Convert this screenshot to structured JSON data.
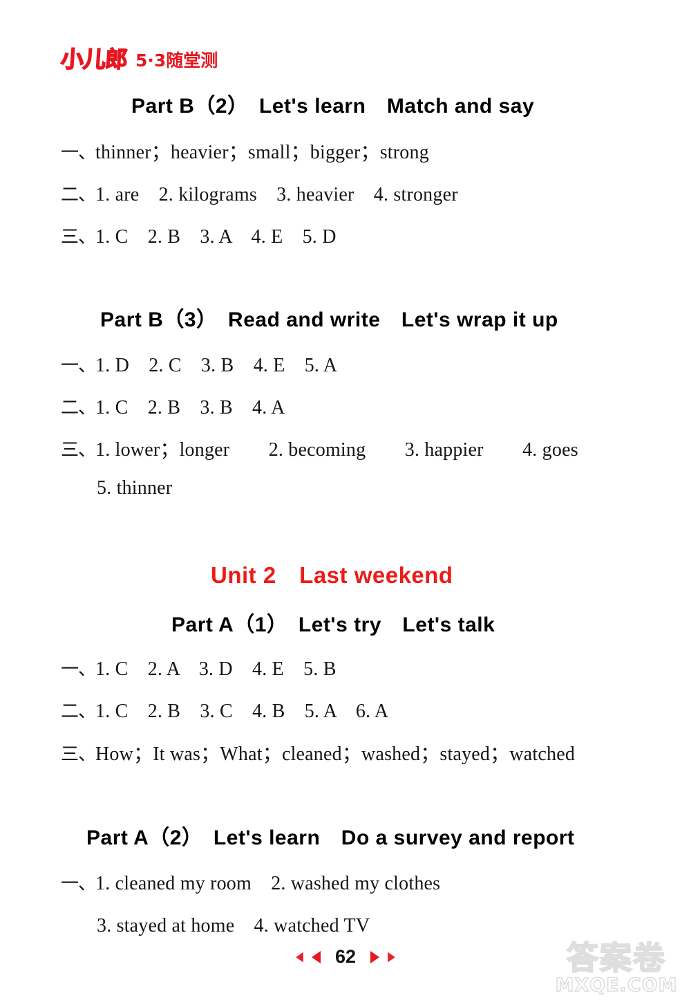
{
  "brand": {
    "logo_text": "小儿郎",
    "logo_sub": "5·3随堂测"
  },
  "sections": [
    {
      "id": "part-b-2",
      "heading": "Part B（2）　Let's learn　Match and say",
      "rows": [
        {
          "marker": "一、",
          "text": "thinner；heavier；small；bigger；strong"
        },
        {
          "marker": "二、",
          "text": "1. are　2. kilograms　3. heavier　4. stronger"
        },
        {
          "marker": "三、",
          "text": "1. C　2. B　3. A　4. E　5. D"
        }
      ]
    },
    {
      "id": "part-b-3",
      "heading": "Part B（3）　Read and write　Let's wrap it up",
      "rows": [
        {
          "marker": "一、",
          "text": "1. D　2. C　3. B　4. E　5. A"
        },
        {
          "marker": "二、",
          "text": "1. C　2. B　3. B　4. A"
        },
        {
          "marker": "三、",
          "text": "1. lower；longer　　2. becoming　　3. happier　　4. goes"
        },
        {
          "marker": "",
          "text": "5. thinner"
        }
      ]
    },
    {
      "id": "unit-2",
      "unit_heading": "Unit 2　Last weekend"
    },
    {
      "id": "part-a-1",
      "heading": "Part A（1）　Let's try　Let's talk",
      "rows": [
        {
          "marker": "一、",
          "text": "1. C　2. A　3. D　4. E　5. B"
        },
        {
          "marker": "二、",
          "text": "1. C　2. B　3. C　4. B　5. A　6. A"
        },
        {
          "marker": "三、",
          "text": "How；It was；What；cleaned；washed；stayed；watched"
        }
      ]
    },
    {
      "id": "part-a-2",
      "heading": "Part A（2）　Let's learn　Do a survey and report",
      "rows": [
        {
          "marker": "一、",
          "text": "1. cleaned my room　2. washed my clothes"
        },
        {
          "marker": "",
          "text": "3. stayed at home　4. watched TV"
        }
      ]
    }
  ],
  "footer": {
    "page_number": "62"
  },
  "watermark": {
    "cn": "答案卷",
    "en": "MXQE.COM"
  },
  "colors": {
    "brand_red": "#e8161f",
    "unit_red": "#ec1c18",
    "text": "#151515",
    "watermark": "#dedede"
  }
}
